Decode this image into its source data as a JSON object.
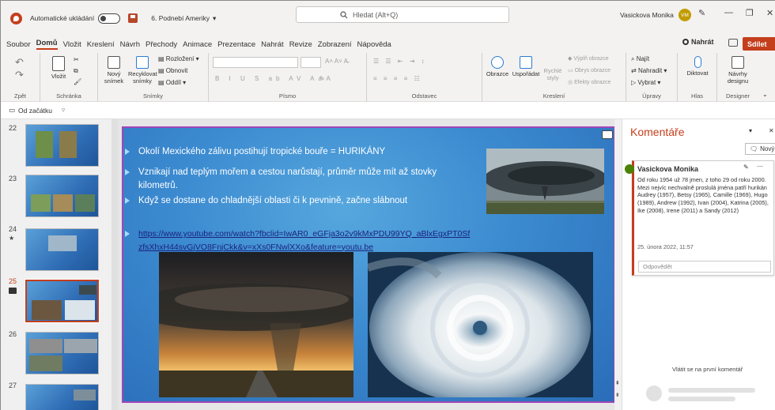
{
  "titlebar": {
    "autosave_label": "Automatické ukládání",
    "file_name": "6. Podnebí Ameriky",
    "search_placeholder": "Hledat (Alt+Q)",
    "user_name": "Vasickova Monika",
    "user_initials": "VM"
  },
  "menu": {
    "items": [
      "Soubor",
      "Domů",
      "Vložit",
      "Kreslení",
      "Návrh",
      "Přechody",
      "Animace",
      "Prezentace",
      "Nahrát",
      "Revize",
      "Zobrazení",
      "Nápověda"
    ],
    "active": "Domů",
    "record_label": "Nahrát",
    "share_label": "Sdílet"
  },
  "ribbon": {
    "undo_group_label": "Zpět",
    "clipboard": {
      "label": "Schránka",
      "paste": "Vložit"
    },
    "slides": {
      "label": "Snímky",
      "new_slide": "Nový snímek",
      "reuse": "Recyklovat snímky",
      "layout": "Rozložení",
      "reset": "Obnovit",
      "section": "Oddíl"
    },
    "font": {
      "label": "Písmo"
    },
    "paragraph": {
      "label": "Odstavec"
    },
    "drawing": {
      "label": "Kreslení",
      "shapes": "Obrazce",
      "arrange": "Uspořádat",
      "quick_styles": "Rychlé styly",
      "fill": "Výplň obrazce",
      "outline": "Obrys obrazce",
      "effects": "Efekty obrazce"
    },
    "editing": {
      "label": "Úpravy",
      "find": "Najít",
      "replace": "Nahradit",
      "select": "Vybrat"
    },
    "voice": {
      "label": "Hlas",
      "dictate": "Diktovat"
    },
    "designer": {
      "label": "Designer",
      "ideas": "Návrhy designu"
    }
  },
  "quickbar": {
    "from_start": "Od začátku"
  },
  "slide_panel": {
    "numbers": [
      "22",
      "23",
      "24",
      "25",
      "26",
      "27"
    ],
    "selected": "25"
  },
  "slide": {
    "bullets": [
      "Okolí Mexického zálivu postihují tropické bouře = HURIKÁNY",
      "Vznikají nad teplým mořem a cestou narůstají, průměr může mít až stovky kilometrů.",
      "Když se dostane do chladnější oblasti či k pevnině, začne slábnout"
    ],
    "link": "https://www.youtube.com/watch?fbclid=IwAR0_eGFja3o2v9kMxPDU99YQ_aBlxEgxPT0SfzfsXhxH44svGjVO8FnjCkk&v=xXs0FNwlXXo&feature=youtu.be"
  },
  "comments": {
    "title": "Komentáře",
    "new_label": "Nový",
    "author": "Vasickova Monika",
    "body": "Od roku 1954  už 78 jmen, z toho 29 od roku 2000.\nMezi nejvíc nechvalně proslulá jména patří hurikán Audrey (1957), Betsy (1965), Camille (1969), Hugo (1989), Andrew (1992), Ivan (2004), Katrina (2005), Ike (2008), Irene (2011) a Sandy (2012)",
    "date": "25. února 2022, 11:57",
    "reply_placeholder": "Odpovědět",
    "first_comment_hint": "Vlátit se na první komentář"
  }
}
